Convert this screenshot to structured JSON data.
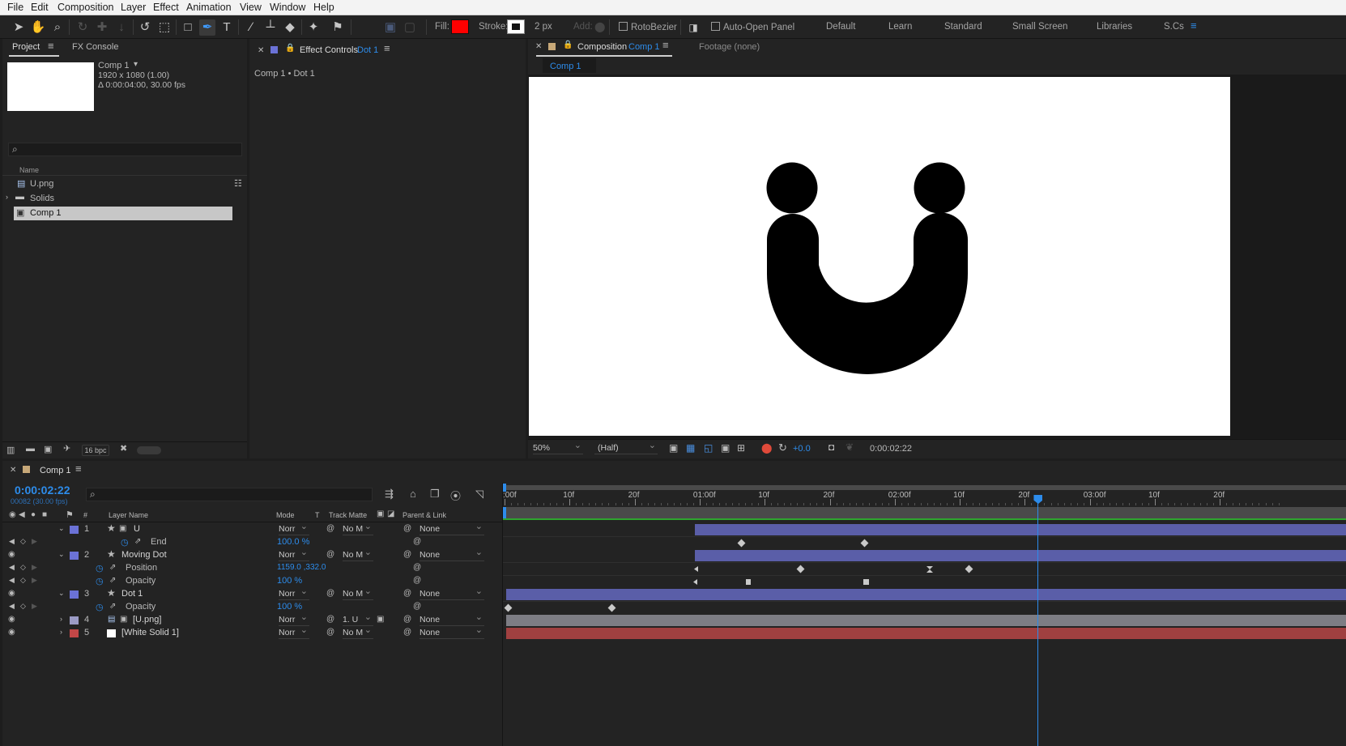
{
  "menu": [
    "File",
    "Edit",
    "Composition",
    "Layer",
    "Effect",
    "Animation",
    "View",
    "Window",
    "Help"
  ],
  "toolbar": {
    "fill_label": "Fill:",
    "stroke_label": "Stroke:",
    "stroke_width": "2 px",
    "add_label": "Add:",
    "rotobezier": "RotoBezier",
    "auto_open": "Auto-Open Panel",
    "workspaces": [
      "Default",
      "Learn",
      "Standard",
      "Small Screen",
      "Libraries"
    ],
    "active_workspace": "S.Cs",
    "fill_color": "#ff0000",
    "accent": "#2d8ceb"
  },
  "project": {
    "tab": "Project",
    "tab2": "FX Console",
    "comp_name": "Comp 1",
    "comp_res": "1920 x 1080 (1.00)",
    "comp_dur": "Δ 0:00:04:00, 30.00 fps",
    "col_name": "Name",
    "items": [
      "U.png",
      "Solids",
      "Comp 1"
    ],
    "bpc": "16 bpc"
  },
  "effects": {
    "title": "Effect Controls",
    "layer": "Dot 1",
    "breadcrumb": "Comp 1 • Dot 1"
  },
  "composition": {
    "title": "Composition",
    "name": "Comp 1",
    "footage": "Footage  (none)",
    "subtab": "Comp 1",
    "zoom": "50%",
    "resolution": "(Half)",
    "exposure": "+0.0",
    "timecode": "0:00:02:22"
  },
  "timeline": {
    "tab": "Comp 1",
    "timecode": "0:00:02:22",
    "frame_info": "00082 (30.00 fps)",
    "headers": {
      "hash": "#",
      "layer_name": "Layer Name",
      "mode": "Mode",
      "t": "T",
      "track_matte": "Track Matte",
      "parent": "Parent & Link"
    },
    "ruler": [
      ":00f",
      "10f",
      "20f",
      "01:00f",
      "10f",
      "20f",
      "02:00f",
      "10f",
      "20f",
      "03:00f",
      "10f",
      "20f"
    ],
    "playhead_frames": 82,
    "layers": [
      {
        "num": "1",
        "name": "U",
        "mode": "Norr",
        "matte": "No M",
        "parent": "None",
        "color": "#6b72d6"
      },
      {
        "prop": "End",
        "value": "100.0 %"
      },
      {
        "num": "2",
        "name": "Moving Dot",
        "mode": "Norr",
        "matte": "No M",
        "parent": "None",
        "color": "#6b72d6"
      },
      {
        "prop": "Position",
        "value": "1159.0 ,332.0"
      },
      {
        "prop": "Opacity",
        "value": "100 %"
      },
      {
        "num": "3",
        "name": "Dot 1",
        "mode": "Norr",
        "matte": "No M",
        "parent": "None",
        "color": "#6b72d6"
      },
      {
        "prop": "Opacity",
        "value": "100 %"
      },
      {
        "num": "4",
        "name": "[U.png]",
        "mode": "Norr",
        "matte": "1. U",
        "parent": "None",
        "color": "#9b9bc5"
      },
      {
        "num": "5",
        "name": "[White Solid 1]",
        "mode": "Norr",
        "matte": "No M",
        "parent": "None",
        "color": "#c24747"
      }
    ]
  }
}
